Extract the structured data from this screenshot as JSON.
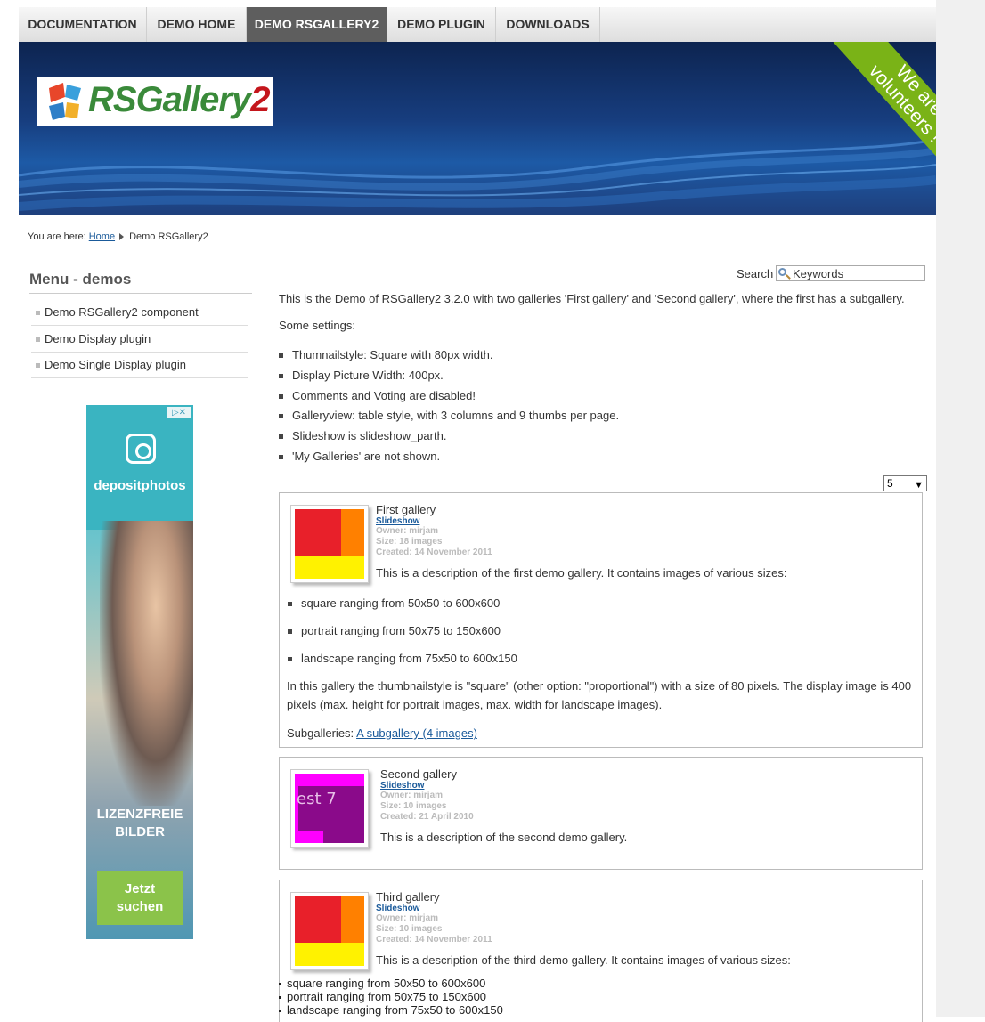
{
  "nav": {
    "items": [
      "DOCUMENTATION",
      "DEMO HOME",
      "DEMO RSGALLERY2",
      "DEMO PLUGIN",
      "DOWNLOADS"
    ]
  },
  "banner": {
    "logo_text_1": "RSGallery",
    "logo_text_2": "2",
    "ribbon_line_1": "We are",
    "ribbon_line_2": "volunteers !"
  },
  "breadcrumb": {
    "prefix": "You are here:",
    "home": "Home",
    "current": "Demo RSGallery2"
  },
  "sidebar": {
    "title": "Menu - demos",
    "items": [
      "Demo RSGallery2 component",
      "Demo Display plugin",
      "Demo Single Display plugin"
    ]
  },
  "ad": {
    "brand": "depositphotos",
    "line_1": "LIZENZFREIE",
    "line_2": "BILDER",
    "button_line_1": "Jetzt",
    "button_line_2": "suchen",
    "close_label": "▷✕"
  },
  "search": {
    "label": "Search",
    "placeholder": "Keywords"
  },
  "intro": {
    "text": "This is the Demo of RSGallery2 3.2.0 with two galleries 'First gallery' and 'Second gallery', where the first has a subgallery.",
    "settings_label": "Some settings:",
    "settings": [
      "Thumnailstyle: Square with 80px width.",
      "Display Picture Width: 400px.",
      "Comments and Voting are disabled!",
      "Galleryview: table style, with 3 columns and 9 thumbs per page.",
      "Slideshow is slideshow_parth.",
      "'My Galleries' are not shown."
    ]
  },
  "pager": {
    "value": "5"
  },
  "galleries": [
    {
      "title": "First gallery",
      "slideshow": "Slideshow",
      "owner": "Owner: mirjam",
      "size": "Size: 18 images",
      "created": "Created: 14 November 2011",
      "description": "This is a description of the first demo gallery. It contains images of various sizes:",
      "items": [
        "square ranging from 50x50 to 600x600",
        "portrait ranging from 50x75 to 150x600",
        "landscape ranging from 75x50 to 600x150"
      ],
      "note": " In this gallery the thumbnailstyle is \"square\" (other option: \"proportional\") with a size of 80 pixels. The display image is 400 pixels (max. height for portrait images, max. width for landscape images).",
      "sub_label": "Subgalleries:",
      "sub_link": "A subgallery (4 images)"
    },
    {
      "title": "Second gallery",
      "slideshow": "Slideshow",
      "owner": "Owner: mirjam",
      "size": "Size: 10 images",
      "created": "Created: 21 April 2010",
      "description": "This is a description of the second demo gallery.",
      "thumb_text": "est 7"
    },
    {
      "title": "Third gallery",
      "slideshow": "Slideshow",
      "owner": "Owner: mirjam",
      "size": "Size: 10 images",
      "created": "Created: 14 November 2011",
      "description": "This is a description of the third demo gallery. It contains images of various sizes:",
      "items": [
        "square ranging from 50x50 to 600x600",
        "portrait ranging from 50x75 to 150x600",
        "landscape ranging from 75x50 to 600x150"
      ]
    }
  ],
  "colors": {
    "nav_active": "#5e5e5e",
    "banner": "#173d7e",
    "ribbon": "#7ab317",
    "link": "#1a5a9a",
    "thumb_red": "#e8202a",
    "thumb_orange": "#ff8000",
    "thumb_yellow": "#fff200",
    "thumb_magenta": "#ff00ff",
    "thumb_purple": "#8a0a8a"
  }
}
